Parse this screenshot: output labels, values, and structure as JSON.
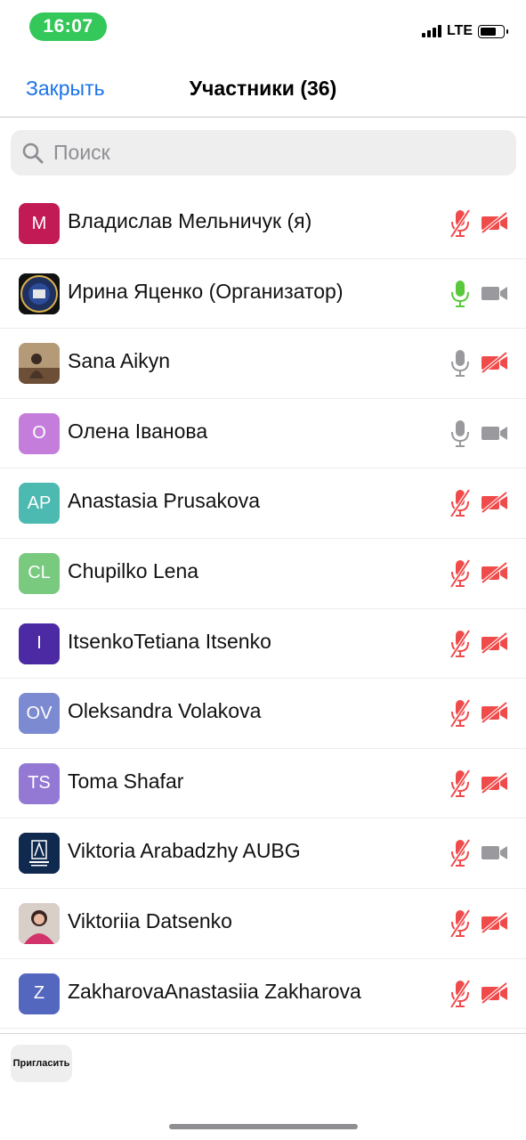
{
  "status_bar": {
    "time": "16:07",
    "network": "LTE",
    "time_pill_color": "#34c759"
  },
  "header": {
    "close_label": "Закрыть",
    "title": "Участники (36)"
  },
  "search": {
    "placeholder": "Поиск",
    "value": ""
  },
  "colors": {
    "accent": "#1a73e8",
    "muted_red": "#f04b4b",
    "unmuted_green": "#5ac83c",
    "inactive_gray": "#9a9a9e"
  },
  "participants": [
    {
      "name": "Владислав Мельничук (я)",
      "initials": "M",
      "avatar_color": "#c21a55",
      "avatar_type": "initials",
      "mic": "muted",
      "cam": "off"
    },
    {
      "name": "Ирина Яценко (Организатор)",
      "initials": "",
      "avatar_color": "#1f2f5e",
      "avatar_type": "emblem",
      "mic": "active",
      "cam": "on"
    },
    {
      "name": "Sana Aikyn",
      "initials": "",
      "avatar_color": "#8a6a4b",
      "avatar_type": "photo",
      "mic": "on",
      "cam": "off"
    },
    {
      "name": "Олена Іванова",
      "initials": "O",
      "avatar_color": "#c57ddb",
      "avatar_type": "initials",
      "mic": "on",
      "cam": "on"
    },
    {
      "name": "Anastasia Prusakova",
      "initials": "AP",
      "avatar_color": "#4cbab0",
      "avatar_type": "initials",
      "mic": "muted",
      "cam": "off"
    },
    {
      "name": "Chupilko Lena",
      "initials": "CL",
      "avatar_color": "#79c97f",
      "avatar_type": "initials",
      "mic": "muted",
      "cam": "off"
    },
    {
      "name": "ItsenkoTetiana Itsenko",
      "initials": "I",
      "avatar_color": "#4b2aa4",
      "avatar_type": "initials",
      "mic": "muted",
      "cam": "off"
    },
    {
      "name": "Oleksandra Volakova",
      "initials": "OV",
      "avatar_color": "#7c8bd1",
      "avatar_type": "initials",
      "mic": "muted",
      "cam": "off"
    },
    {
      "name": "Toma Shafar",
      "initials": "TS",
      "avatar_color": "#9479d4",
      "avatar_type": "initials",
      "mic": "muted",
      "cam": "off"
    },
    {
      "name": "Viktoria Arabadzhy AUBG",
      "initials": "",
      "avatar_color": "#10294f",
      "avatar_type": "logo",
      "mic": "muted",
      "cam": "on"
    },
    {
      "name": "Viktoriia Datsenko",
      "initials": "",
      "avatar_color": "#c53a70",
      "avatar_type": "photo2",
      "mic": "muted",
      "cam": "off"
    },
    {
      "name": "ZakharovaAnastasiia Zakharova",
      "initials": "Z",
      "avatar_color": "#5467bf",
      "avatar_type": "initials",
      "mic": "muted",
      "cam": "off"
    }
  ],
  "footer": {
    "invite_label": "Пригласить"
  }
}
